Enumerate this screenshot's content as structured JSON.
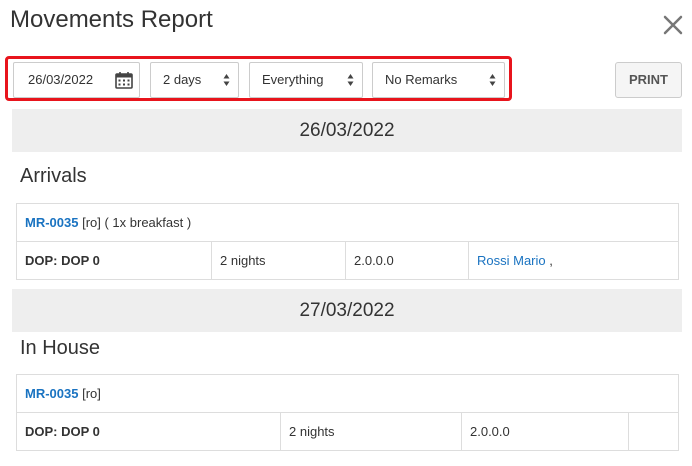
{
  "header": {
    "title": "Movements Report"
  },
  "toolbar": {
    "date_value": "26/03/2022",
    "days_value": "2 days",
    "scope_value": "Everything",
    "remarks_value": "No Remarks",
    "print_label": "PRINT"
  },
  "days": [
    {
      "date": "26/03/2022",
      "section": "Arrivals",
      "booking": {
        "code": "MR-0035",
        "detail": "[ro] ( 1x breakfast )"
      },
      "row": {
        "dop": "DOP: DOP 0",
        "nights": "2 nights",
        "version": "2.0.0.0",
        "guest": "Rossi Mario",
        "guest_suffix": ","
      }
    },
    {
      "date": "27/03/2022",
      "section": "In House",
      "booking": {
        "code": "MR-0035",
        "detail": "[ro]"
      },
      "row": {
        "dop": "DOP: DOP 0",
        "nights": "2 nights",
        "version": "2.0.0.0",
        "guest": ""
      }
    }
  ],
  "colors": {
    "highlight": "#e8141c",
    "link": "#1a73c1",
    "band": "#eeeeee"
  }
}
